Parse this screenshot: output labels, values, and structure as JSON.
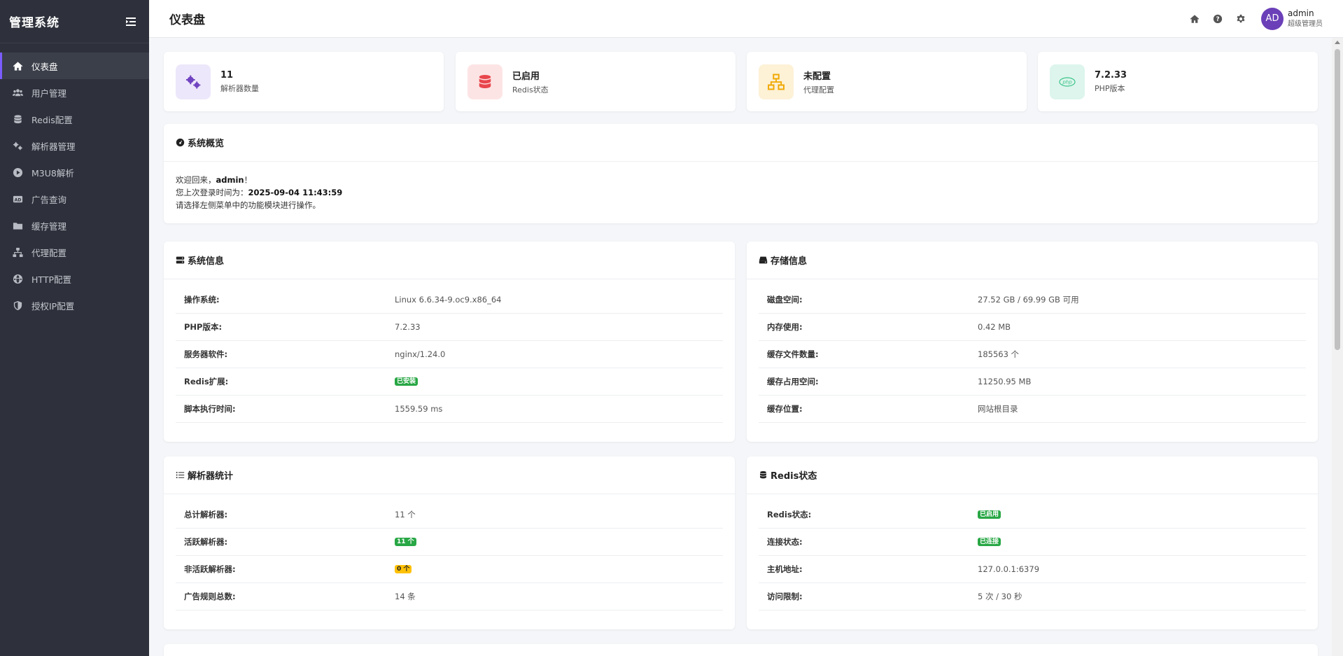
{
  "sidebar": {
    "title": "管理系统",
    "items": [
      {
        "label": "仪表盘",
        "icon": "home-icon"
      },
      {
        "label": "用户管理",
        "icon": "users-icon"
      },
      {
        "label": "Redis配置",
        "icon": "database-icon"
      },
      {
        "label": "解析器管理",
        "icon": "cogs-icon"
      },
      {
        "label": "M3U8解析",
        "icon": "play-icon"
      },
      {
        "label": "广告查询",
        "icon": "ad-icon"
      },
      {
        "label": "缓存管理",
        "icon": "folder-icon"
      },
      {
        "label": "代理配置",
        "icon": "sitemap-icon"
      },
      {
        "label": "HTTP配置",
        "icon": "globe-icon"
      },
      {
        "label": "授权IP配置",
        "icon": "shield-icon"
      }
    ]
  },
  "topbar": {
    "title": "仪表盘",
    "user": {
      "initials": "AD",
      "name": "admin",
      "role": "超级管理员"
    }
  },
  "stats": [
    {
      "value": "11",
      "label": "解析器数量",
      "icon": "cogs-icon",
      "color": "#6f42c1",
      "bg": "#ede7fb"
    },
    {
      "value": "已启用",
      "label": "Redis状态",
      "icon": "database-icon",
      "color": "#e8464c",
      "bg": "#fde4e4"
    },
    {
      "value": "未配置",
      "label": "代理配置",
      "icon": "sitemap-icon",
      "color": "#f0a800",
      "bg": "#fdf1d6"
    },
    {
      "value": "7.2.33",
      "label": "PHP版本",
      "icon": "php-icon",
      "color": "#3cc48b",
      "bg": "#ddf5ec"
    }
  ],
  "overview": {
    "title": "系统概览",
    "welcome_prefix": "欢迎回来，",
    "welcome_user": "admin",
    "welcome_suffix": "！",
    "last_login_prefix": "您上次登录时间为：",
    "last_login_time": "2025-09-04 11:43:59",
    "hint": "请选择左侧菜单中的功能模块进行操作。"
  },
  "system_info": {
    "title": "系统信息",
    "rows": [
      {
        "key": "操作系统:",
        "value": "Linux 6.6.34-9.oc9.x86_64"
      },
      {
        "key": "PHP版本:",
        "value": "7.2.33"
      },
      {
        "key": "服务器软件:",
        "value": "nginx/1.24.0"
      },
      {
        "key": "Redis扩展:",
        "badge": "已安装"
      },
      {
        "key": "脚本执行时间:",
        "value": "1559.59 ms"
      }
    ]
  },
  "storage_info": {
    "title": "存储信息",
    "rows": [
      {
        "key": "磁盘空间:",
        "value": "27.52 GB / 69.99 GB 可用"
      },
      {
        "key": "内存使用:",
        "value": "0.42 MB"
      },
      {
        "key": "缓存文件数量:",
        "value": "185563 个"
      },
      {
        "key": "缓存占用空间:",
        "value": "11250.95 MB"
      },
      {
        "key": "缓存位置:",
        "value": "网站根目录"
      }
    ]
  },
  "parser_stats": {
    "title": "解析器统计",
    "rows": [
      {
        "key": "总计解析器:",
        "value": "11 个"
      },
      {
        "key": "活跃解析器:",
        "badge": "11 个"
      },
      {
        "key": "非活跃解析器:",
        "badge": "0 个",
        "warn": true
      },
      {
        "key": "广告规则总数:",
        "value": "14 条"
      }
    ]
  },
  "redis_status": {
    "title": "Redis状态",
    "rows": [
      {
        "key": "Redis状态:",
        "badge": "已启用"
      },
      {
        "key": "连接状态:",
        "badge": "已连接"
      },
      {
        "key": "主机地址:",
        "value": "127.0.0.1:6379"
      },
      {
        "key": "访问限制:",
        "value": "5 次 / 30 秒"
      }
    ]
  }
}
